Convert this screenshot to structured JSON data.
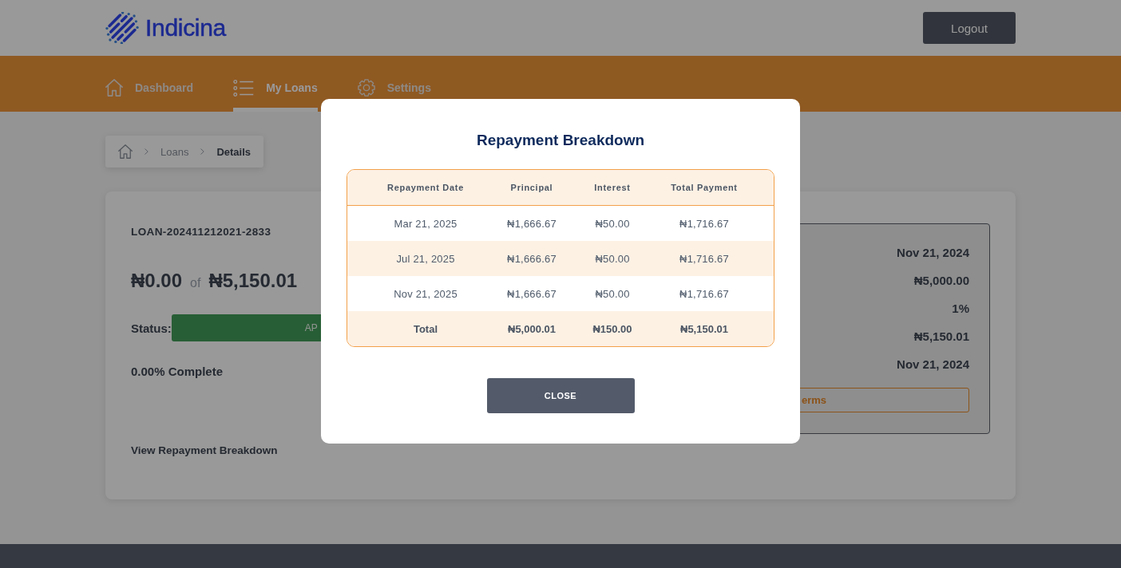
{
  "header": {
    "logo_text": "Indicina",
    "logout_button": "Logout"
  },
  "nav": {
    "tabs": [
      {
        "label": "Dashboard",
        "selected": false
      },
      {
        "label": "My Loans",
        "selected": true
      },
      {
        "label": "Settings",
        "selected": false
      }
    ]
  },
  "breadcrumb": {
    "items": [
      {
        "label": "Loans",
        "current": false
      },
      {
        "label": "Details",
        "current": true
      }
    ]
  },
  "loan": {
    "id": "LOAN-202411212021-2833",
    "paid": "₦0.00",
    "of": "of",
    "total": "₦5,150.01",
    "status_label": "Status:",
    "status": "AP",
    "progress": "0.00% Complete",
    "breakdown_link": "View Repayment Breakdown"
  },
  "summary": {
    "values": [
      "Nov 21, 2024",
      "₦5,000.00",
      "1%",
      "₦5,150.01",
      "Nov 21, 2024"
    ],
    "button": "erms"
  },
  "modal": {
    "title": "Repayment Breakdown",
    "table": {
      "columns": [
        "Repayment Date",
        "Principal",
        "Interest",
        "Total Payment"
      ],
      "rows": [
        [
          "Mar 21, 2025",
          "₦1,666.67",
          "₦50.00",
          "₦1,716.67"
        ],
        [
          "Jul 21, 2025",
          "₦1,666.67",
          "₦50.00",
          "₦1,716.67"
        ],
        [
          "Nov 21, 2025",
          "₦1,666.67",
          "₦50.00",
          "₦1,716.67"
        ]
      ],
      "total": [
        "Total",
        "₦5,000.01",
        "₦150.00",
        "₦5,150.01"
      ]
    },
    "close_button": "CLOSE"
  }
}
